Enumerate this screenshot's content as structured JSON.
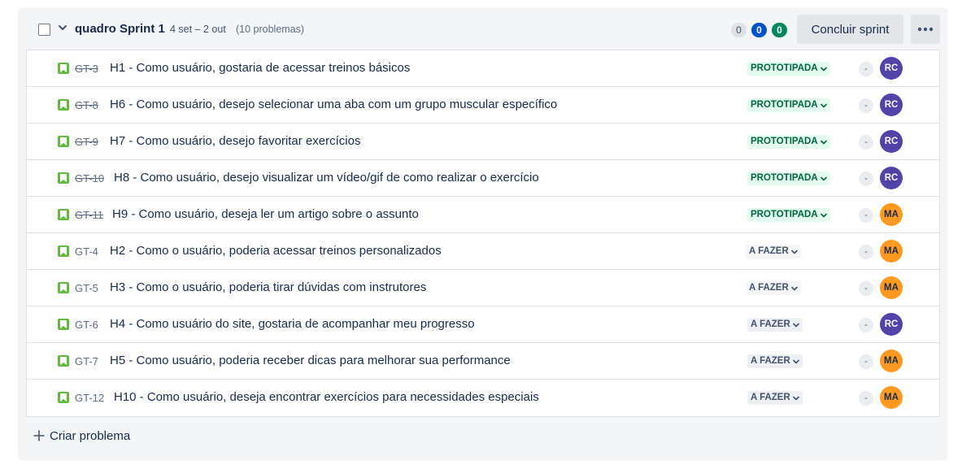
{
  "sprint": {
    "name": "quadro Sprint 1",
    "dates": "4 set – 2 out",
    "issue_count": "(10 problemas)",
    "counts": {
      "todo": "0",
      "in_progress": "0",
      "done": "0"
    },
    "complete_button": "Concluir sprint",
    "more_icon": "more-horizontal-icon"
  },
  "issues": [
    {
      "key": "GT-3",
      "done": true,
      "summary": "H1 - Como usuário, gostaria de acessar treinos básicos",
      "status": "PROTOTIPADA",
      "estimate": "-",
      "assignee": "RC"
    },
    {
      "key": "GT-8",
      "done": true,
      "summary": "H6 - Como usuário, desejo selecionar uma aba com um grupo muscular específico",
      "status": "PROTOTIPADA",
      "estimate": "-",
      "assignee": "RC"
    },
    {
      "key": "GT-9",
      "done": true,
      "summary": "H7 - Como usuário, desejo favoritar exercícios",
      "status": "PROTOTIPADA",
      "estimate": "-",
      "assignee": "RC"
    },
    {
      "key": "GT-10",
      "done": true,
      "summary": "H8 - Como usuário, desejo visualizar um vídeo/gif de como realizar o exercício",
      "status": "PROTOTIPADA",
      "estimate": "-",
      "assignee": "RC"
    },
    {
      "key": "GT-11",
      "done": true,
      "summary": "H9 - Como usuário, deseja ler um artigo sobre o assunto",
      "status": "PROTOTIPADA",
      "estimate": "-",
      "assignee": "MA"
    },
    {
      "key": "GT-4",
      "done": false,
      "summary": "H2 - Como o usuário, poderia acessar treinos personalizados",
      "status": "A FAZER",
      "estimate": "-",
      "assignee": "MA"
    },
    {
      "key": "GT-5",
      "done": false,
      "summary": "H3 - Como o usuário, poderia tirar dúvidas com instrutores",
      "status": "A FAZER",
      "estimate": "-",
      "assignee": "MA"
    },
    {
      "key": "GT-6",
      "done": false,
      "summary": "H4 - Como usuário do site, gostaria de acompanhar meu progresso",
      "status": "A FAZER",
      "estimate": "-",
      "assignee": "RC"
    },
    {
      "key": "GT-7",
      "done": false,
      "summary": "H5 - Como usuário, poderia receber dicas para melhorar sua performance",
      "status": "A FAZER",
      "estimate": "-",
      "assignee": "MA"
    },
    {
      "key": "GT-12",
      "done": false,
      "summary": "H10 - Como usuário, deseja encontrar exercícios para necessidades especiais",
      "status": "A FAZER",
      "estimate": "-",
      "assignee": "MA"
    }
  ],
  "create_issue": {
    "label": "Criar problema",
    "icon": "plus-icon"
  },
  "colors": {
    "story_icon": "#63ba3c",
    "prototipada_bg": "#e3fcef",
    "prototipada_text": "#006644",
    "avatar_rc": "#5243aa",
    "avatar_ma": "#ff991f",
    "count_in_progress": "#0052cc",
    "count_done": "#00875a"
  }
}
